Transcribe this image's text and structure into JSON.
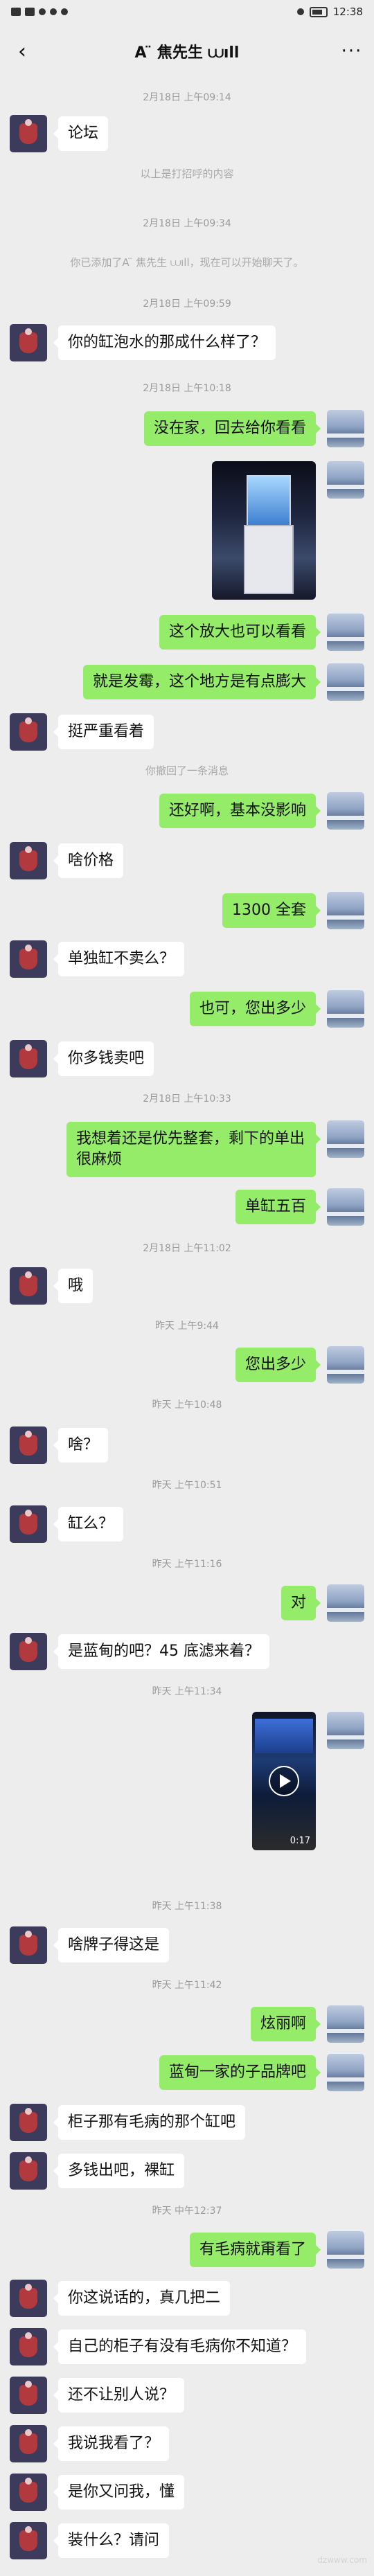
{
  "status": {
    "time": "12:38"
  },
  "header": {
    "title": "A ̈  焦先生 ⩊ıll",
    "back_icon": "chevron-left-icon",
    "more_icon": "more-dots-icon"
  },
  "messages": {
    "t1": "2月18日 上午09:14",
    "m1": "论坛",
    "s1": "以上是打招呼的内容",
    "t2": "2月18日 上午09:34",
    "s2": "你已添加了A ̈ 焦先生 ⩊ıll，现在可以开始聊天了。",
    "t3": "2月18日 上午09:59",
    "m2": "你的缸泡水的那成什么样了？",
    "t4": "2月18日 上午10:18",
    "m3": "没在家，回去给你看看",
    "m4": "这个放大也可以看看",
    "m5": "就是发霉，这个地方是有点膨大",
    "m6": "挺严重看着",
    "s3": "你撤回了一条消息",
    "m7": "还好啊，基本没影响",
    "m8": "啥价格",
    "m9": "1300 全套",
    "m10": "单独缸不卖么？",
    "m11": "也可，您出多少",
    "m12": "你多钱卖吧",
    "t5": "2月18日 上午10:33",
    "m13": "我想着还是优先整套，剩下的单出很麻烦",
    "m14": "单缸五百",
    "t6": "2月18日 上午11:02",
    "m15": "哦",
    "t7": "昨天 上午9:44",
    "m16": "您出多少",
    "t8": "昨天 上午10:48",
    "m17": "啥？",
    "t9": "昨天 上午10:51",
    "m18": "缸么？",
    "t10": "昨天 上午11:16",
    "m19": "对",
    "m20": "是蓝甸的吧？45 底滤来着？",
    "t11": "昨天 上午11:34",
    "video_duration": "0:17",
    "t12": "昨天 上午11:38",
    "m21": "啥牌子得这是",
    "t13": "昨天 上午11:42",
    "m22": "炫丽啊",
    "m23": "蓝甸一家的子品牌吧",
    "m24": "柜子那有毛病的那个缸吧",
    "m25": "多钱出吧，裸缸",
    "t14": "昨天 中午12:37",
    "m26": "有毛病就甭看了",
    "m27": "你这说话的，真几把二",
    "m28": "自己的柜子有没有毛病你不知道？",
    "m29": "还不让别人说？",
    "m30": "我说我看了？",
    "m31": "是你又问我，懂",
    "m32": "装什么？请问"
  },
  "watermark": "dzwww.com"
}
